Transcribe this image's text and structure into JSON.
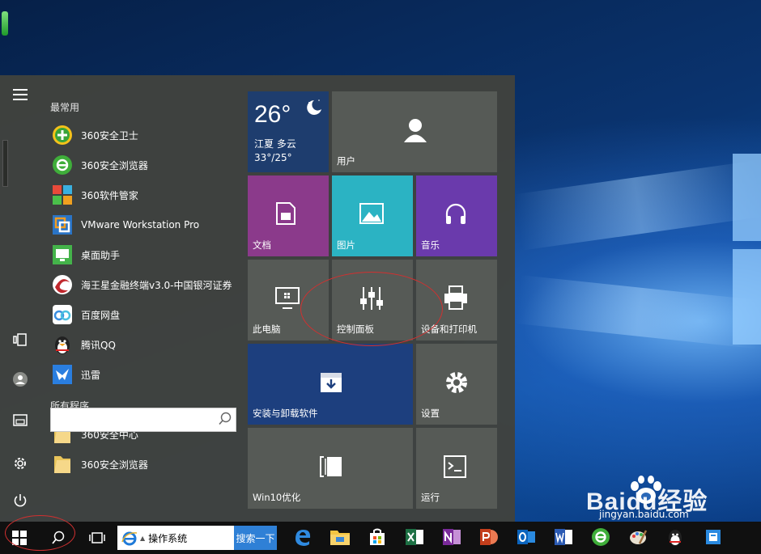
{
  "start_menu": {
    "sections": {
      "most_used": "最常用",
      "all_programs": "所有程序"
    },
    "most_used_apps": [
      {
        "label": "360安全卫士",
        "icon": "plus-shield",
        "color": "#3aa33a"
      },
      {
        "label": "360安全浏览器",
        "icon": "e-browser",
        "color": "#3fae3a"
      },
      {
        "label": "360软件管家",
        "icon": "multicolor-squares",
        "color": "#e05a3a"
      },
      {
        "label": "VMware Workstation Pro",
        "icon": "vmware",
        "color": "#2a74c6"
      },
      {
        "label": "桌面助手",
        "icon": "monitor",
        "color": "#44b34a"
      },
      {
        "label": "海王星金融终端v3.0-中国银河证券",
        "icon": "galaxy-swirl",
        "color": "#c0282d"
      },
      {
        "label": "百度网盘",
        "icon": "cloud",
        "color": "#3a8ee0"
      },
      {
        "label": "腾讯QQ",
        "icon": "penguin",
        "color": "#222222"
      },
      {
        "label": "迅雷",
        "icon": "bird",
        "color": "#2a7ee0"
      }
    ],
    "all_programs_apps": [
      {
        "label": "360安全中心",
        "icon": "folder",
        "color": "#e8c45a"
      },
      {
        "label": "360安全浏览器",
        "icon": "folder",
        "color": "#e8c45a"
      }
    ],
    "search": {
      "value": "",
      "placeholder": ""
    },
    "tiles": {
      "weather": {
        "temp": "26°",
        "location": "江夏 多云",
        "range": "33°/25°",
        "color": "#1e3d6e"
      },
      "user": {
        "label": "用户",
        "color": "#565a56"
      },
      "documents": {
        "label": "文档",
        "color": "#8b3a8b"
      },
      "pictures": {
        "label": "图片",
        "color": "#2bb3c3"
      },
      "music": {
        "label": "音乐",
        "color": "#6a3aac"
      },
      "this_pc": {
        "label": "此电脑",
        "color": "#565a56"
      },
      "control_panel": {
        "label": "控制面板",
        "color": "#565a56"
      },
      "devices_printers": {
        "label": "设备和打印机",
        "color": "#565a56"
      },
      "programs_features": {
        "label": "安装与卸载软件",
        "color": "#1d3f7e"
      },
      "settings": {
        "label": "设置",
        "color": "#565a56"
      },
      "win10_optimize": {
        "label": "Win10优化",
        "color": "#565a56"
      },
      "run": {
        "label": "运行",
        "color": "#565a56"
      }
    }
  },
  "taskbar": {
    "ie_address": "操作系统",
    "ie_go": "搜索一下",
    "pinned": [
      "edge-icon",
      "file-explorer-icon",
      "store-icon",
      "excel-icon",
      "onenote-icon",
      "powerpoint-icon",
      "outlook-icon",
      "word-icon",
      "360-browser-icon",
      "paint-icon",
      "qq-icon",
      "system-tray-icon"
    ]
  },
  "watermark": {
    "brand": "Baidu经验",
    "url": "jingyan.baidu.com"
  },
  "colors": {
    "menu_bg": "#40423e",
    "taskbar_bg": "#101010",
    "annotation": "#d23030"
  }
}
